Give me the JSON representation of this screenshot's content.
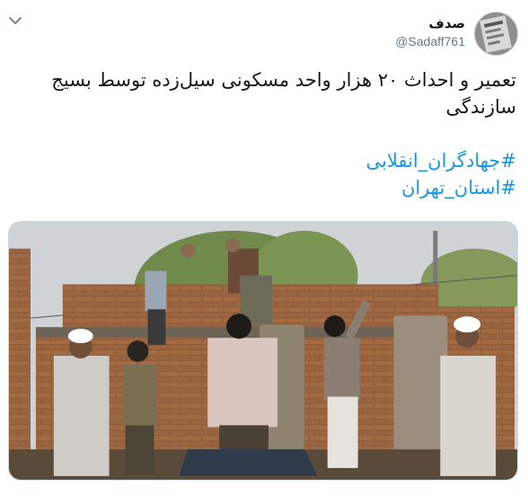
{
  "header": {
    "display_name": "صدف",
    "handle": "@Sadaff761",
    "menu_icon": "chevron-down-icon",
    "avatar_icon": "avatar"
  },
  "tweet": {
    "line1": "تعمیر و احداث ۲۰ هزار واحد مسکونی سیل‌زده توسط بسیج",
    "line2": "سازندگی",
    "hashtags": [
      "#جهادگران_انقلابی",
      "#استان_تهران"
    ]
  },
  "media": {
    "description_icon": "photo"
  },
  "colors": {
    "link": "#1b95e0",
    "text": "#14171a",
    "secondary": "#657786",
    "border": "#ccd6dd"
  }
}
